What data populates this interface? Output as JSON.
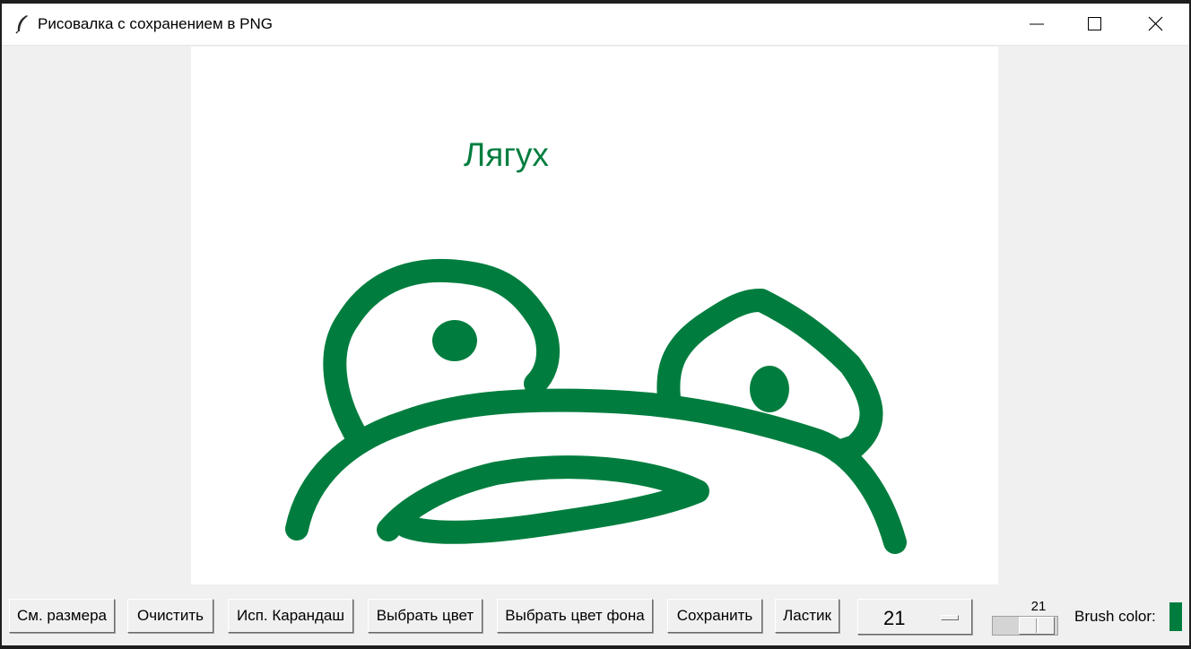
{
  "window": {
    "title": "Рисовалка с сохранением в PNG",
    "icon": "feather-icon",
    "controls": [
      "minimize-icon",
      "maximize-icon",
      "close-icon"
    ]
  },
  "canvas": {
    "background": "#ffffff",
    "stroke_color": "#007d3e",
    "text": "Лягух"
  },
  "toolbar": {
    "resize_label": "См. размера",
    "clear_label": "Очистить",
    "pencil_label": "Исп. Карандаш",
    "color_label": "Выбрать цвет",
    "bg_color_label": "Выбрать цвет фона",
    "save_label": "Сохранить",
    "eraser_label": "Ластик",
    "size_option": "21",
    "scale_value": "21",
    "brush_color_label": "Brush color:",
    "brush_color": "#007d3e"
  }
}
